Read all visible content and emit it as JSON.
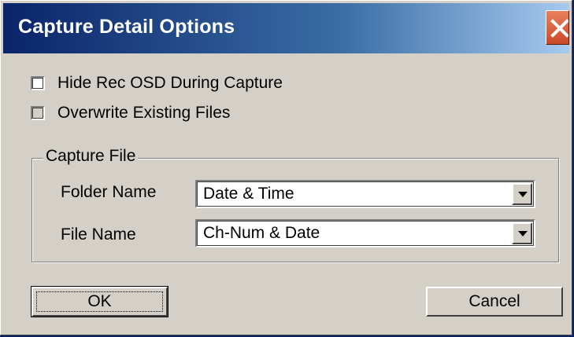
{
  "window": {
    "title": "Capture Detail Options",
    "close_icon": "close-icon"
  },
  "options": [
    {
      "label": "Hide Rec OSD During Capture",
      "checked": false
    },
    {
      "label": "Overwrite Existing Files",
      "checked": false
    }
  ],
  "capture_file": {
    "legend": "Capture File",
    "folder_name": {
      "label": "Folder Name",
      "value": "Date & Time"
    },
    "file_name": {
      "label": "File Name",
      "value": "Ch-Num & Date"
    }
  },
  "buttons": {
    "ok": "OK",
    "cancel": "Cancel"
  },
  "colors": {
    "title_bar_start": "#0a246a",
    "title_bar_end": "#a6caf0",
    "face": "#d4d0c8",
    "close_button": "#d9643f"
  }
}
